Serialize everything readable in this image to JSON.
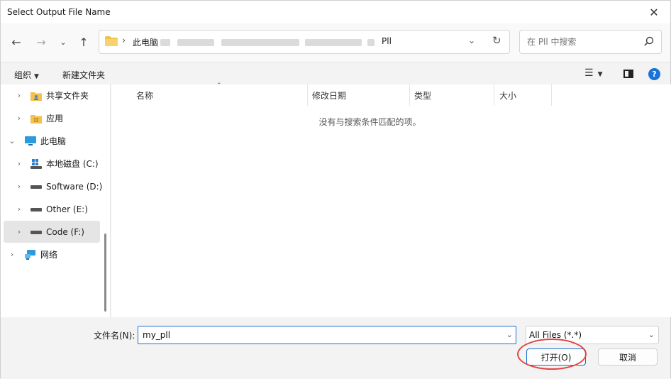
{
  "window": {
    "title": "Select Output File Name"
  },
  "nav": {
    "path_root": "此电脑",
    "path_current": "Pll",
    "search_placeholder": "在 Pll 中搜索"
  },
  "toolbar": {
    "organize": "组织",
    "new_folder": "新建文件夹"
  },
  "sidebar": {
    "items": [
      {
        "label": "共享文件夹",
        "icon": "shared-folder-icon",
        "expanded": false
      },
      {
        "label": "应用",
        "icon": "apps-folder-icon",
        "expanded": false
      },
      {
        "label": "此电脑",
        "icon": "computer-icon",
        "expanded": true
      },
      {
        "label": "本地磁盘 (C:)",
        "icon": "windows-drive-icon",
        "expanded": false
      },
      {
        "label": "Software (D:)",
        "icon": "drive-icon",
        "expanded": false
      },
      {
        "label": "Other (E:)",
        "icon": "drive-icon",
        "expanded": false
      },
      {
        "label": "Code (F:)",
        "icon": "drive-icon",
        "expanded": false,
        "selected": true
      },
      {
        "label": "网络",
        "icon": "network-icon",
        "expanded": false
      }
    ]
  },
  "filelist": {
    "columns": [
      "名称",
      "修改日期",
      "类型",
      "大小"
    ],
    "empty_message": "没有与搜索条件匹配的项。"
  },
  "bottom": {
    "filename_label": "文件名(N):",
    "filename_value": "my_pll",
    "filetype_value": "All Files (*.*)",
    "open_button": "打开(O)",
    "cancel_button": "取消"
  },
  "colors": {
    "accent": "#1a6fc9",
    "highlight_ring": "#e04545",
    "folder_yellow": "#f2c14e"
  }
}
